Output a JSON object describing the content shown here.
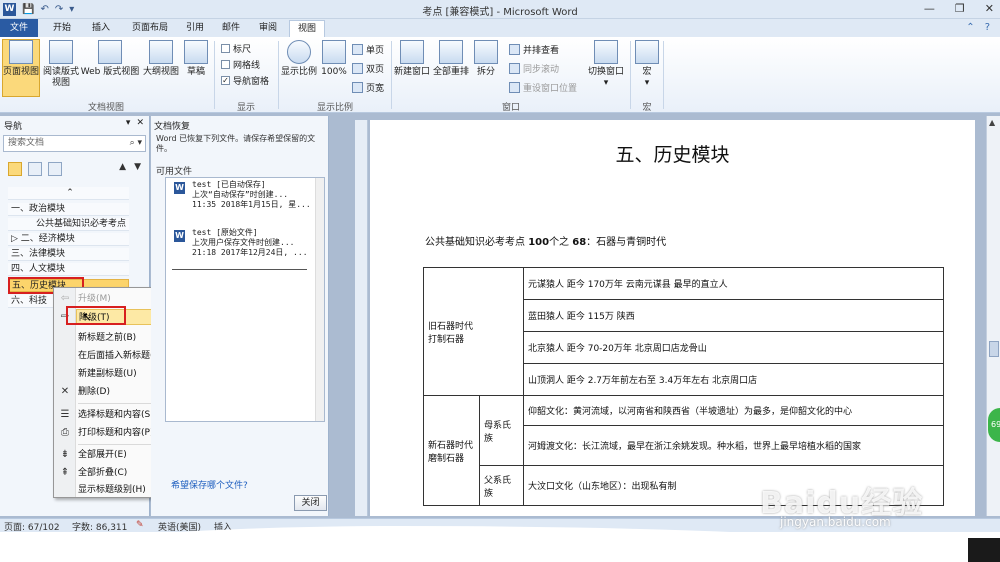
{
  "window": {
    "title": "考点 [兼容模式] - Microsoft Word",
    "qat_icons": [
      "word-logo-icon",
      "save-icon",
      "undo-icon",
      "redo-icon",
      "customize-qat-icon"
    ],
    "controls": [
      "—",
      "❐",
      "✕"
    ]
  },
  "tabs": [
    {
      "label": "文件",
      "type": "file"
    },
    {
      "label": "开始"
    },
    {
      "label": "插入"
    },
    {
      "label": "页面布局"
    },
    {
      "label": "引用"
    },
    {
      "label": "邮件"
    },
    {
      "label": "审阅"
    },
    {
      "label": "视图",
      "active": true
    }
  ],
  "ribbon": {
    "doc_views": {
      "group_label": "文档视图",
      "buttons": [
        "页面视图",
        "阅读版式\n视图",
        "Web 版式视图",
        "大纲视图",
        "草稿"
      ]
    },
    "show": {
      "group_label": "显示",
      "items": [
        {
          "label": "标尺",
          "checked": false
        },
        {
          "label": "网格线",
          "checked": false
        },
        {
          "label": "导航窗格",
          "checked": true
        }
      ]
    },
    "zoom": {
      "group_label": "显示比例",
      "buttons": [
        "显示比例",
        "100%"
      ],
      "small": [
        "单页",
        "双页",
        "页宽"
      ]
    },
    "window": {
      "group_label": "窗口",
      "buttons": [
        "新建窗口",
        "全部重排",
        "拆分"
      ],
      "small": [
        "并排查看",
        "同步滚动",
        "重设窗口位置"
      ],
      "switch": "切换窗口"
    },
    "macros": {
      "group_label": "宏",
      "button": "宏"
    }
  },
  "nav_pane": {
    "title": "导航",
    "search_placeholder": "搜索文档",
    "items": [
      {
        "label": "一、政治模块",
        "level": 1
      },
      {
        "label": "公共基础知识必考考点",
        "level": 2
      },
      {
        "label": "二、经济模块",
        "level": 1,
        "collapsed": true
      },
      {
        "label": "三、法律模块",
        "level": 1
      },
      {
        "label": "四、人文模块",
        "level": 1
      },
      {
        "label": "五、历史模块",
        "level": 1,
        "selected": true
      },
      {
        "label": "六、科技",
        "level": 1
      }
    ]
  },
  "context_menu": {
    "items": [
      {
        "label": "升级(M)",
        "disabled": true
      },
      {
        "label": "降级(T)",
        "highlighted": true
      },
      {
        "label": "新标题之前(B)"
      },
      {
        "label": "在后面插入新标题(A)"
      },
      {
        "label": "新建副标题(U)"
      },
      {
        "label": "删除(D)"
      },
      {
        "label": "选择标题和内容(S)"
      },
      {
        "label": "打印标题和内容(P)"
      },
      {
        "label": "全部展开(E)"
      },
      {
        "label": "全部折叠(C)"
      },
      {
        "label": "显示标题级别(H)"
      }
    ]
  },
  "recovery": {
    "title": "文档恢复",
    "message": "Word 已恢复下列文件。请保存希望保留的文件。",
    "available_label": "可用文件",
    "files": [
      {
        "name": "test [已自动保存]",
        "desc": "上次“自动保存”时创建...",
        "time": "11:35 2018年1月15日, 星..."
      },
      {
        "name": "test [原始文件]",
        "desc": "上次用户保存文件时创建...",
        "time": "21:18 2017年12月24日, ..."
      }
    ],
    "link": "希望保存哪个文件?",
    "close_label": "关闭"
  },
  "document": {
    "heading": "五、历史模块",
    "intro_prefix": "公共基础知识必考考点 ",
    "intro_bold1": "100",
    "intro_mid": "个之 ",
    "intro_bold2": "68",
    "intro_suffix": "：石器与青铜时代",
    "table": {
      "paleo_label": "旧石器时代\n打制石器",
      "paleo_rows": [
        "元谋猿人 距今 170万年 云南元谋县 最早的直立人",
        "蓝田猿人 距今 115万 陕西",
        "北京猿人 距今 70-20万年 北京周口店龙骨山",
        "山顶洞人 距今 2.7万年前左右至 3.4万年左右 北京周口店"
      ],
      "neo_label": "新石器时代\n磨制石器",
      "matri_label": "母系氏族",
      "matri_rows": [
        "仰韶文化：黄河流域，以河南省和陕西省（半坡遗址）为最多，是仰韶文化的中心",
        "河姆渡文化：长江流域，最早在浙江余姚发现。种水稻，世界上最早培植水稻的国家"
      ],
      "patri_label": "父系氏族",
      "patri_rows": [
        "大汶口文化（山东地区）：出现私有制"
      ]
    }
  },
  "status": {
    "page": "页面: 67/102",
    "words": "字数: 86,311",
    "language": "英语(美国)",
    "mode": "插入"
  },
  "watermark": {
    "logo": "Baidu经验",
    "url": "jingyan.baidu.com",
    "badge": "69"
  }
}
